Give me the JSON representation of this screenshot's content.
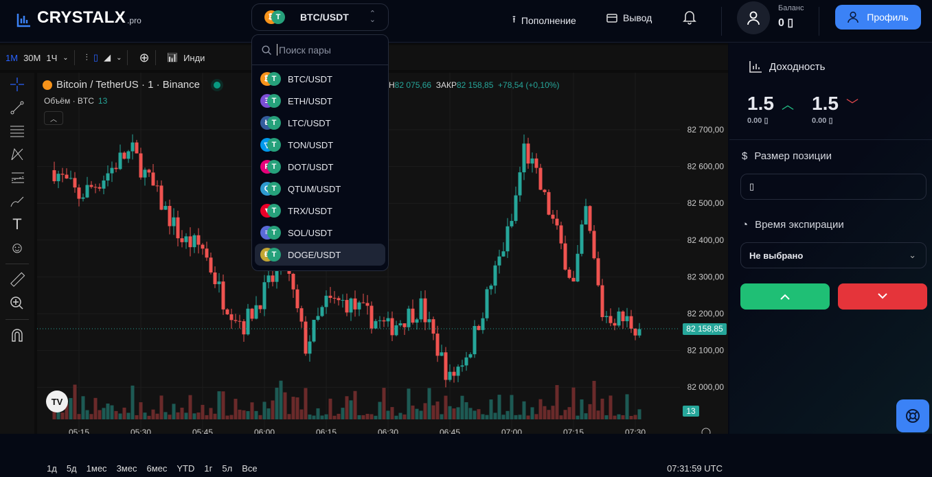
{
  "header": {
    "logo": "CRYSTALX",
    "logo_suffix": ".pro",
    "pair": "BTC/USDT",
    "deposit": "Пополнение",
    "withdraw": "Вывод",
    "balance_label": "Баланс",
    "balance_value": "0 ▯",
    "profile": "Профиль"
  },
  "toolbar": {
    "intervals": [
      "1М",
      "30М",
      "1Ч"
    ],
    "active_interval": "1М",
    "indicators": "Инди"
  },
  "chart": {
    "title": "Bitcoin / TetherUS · 1 · Binance",
    "volume_label": "Объём · BTC",
    "volume_value": "13",
    "ohlc_prefix": "Н",
    "low": "82 075,66",
    "close_label": "ЗАКР",
    "close": "82 158,85",
    "change": "+78,54 (+0,10%)",
    "price_ticks": [
      "82 700,00",
      "82 600,00",
      "82 500,00",
      "82 400,00",
      "82 300,00",
      "82 200,00",
      "82 100,00",
      "82 000,00"
    ],
    "current_price": "82 158,85",
    "volume_badge": "13",
    "time_ticks": [
      "05:15",
      "05:30",
      "05:45",
      "06:00",
      "06:15",
      "06:30",
      "06:45",
      "07:00",
      "07:15",
      "07:30"
    ],
    "ranges": [
      "1д",
      "5д",
      "1мес",
      "3мес",
      "6мес",
      "YTD",
      "1г",
      "5л",
      "Все"
    ],
    "clock": "07:31:59 UTC",
    "up_color": "#26a69a",
    "down_color": "#ef5350",
    "path": [
      [
        "05:09",
        82590
      ],
      [
        "05:15",
        82520
      ],
      [
        "05:20",
        82560
      ],
      [
        "05:25",
        82620
      ],
      [
        "05:28",
        82640
      ],
      [
        "05:35",
        82500
      ],
      [
        "05:40",
        82400
      ],
      [
        "05:45",
        82380
      ],
      [
        "05:50",
        82240
      ],
      [
        "05:55",
        82170
      ],
      [
        "06:00",
        82260
      ],
      [
        "06:05",
        82340
      ],
      [
        "06:10",
        82110
      ],
      [
        "06:15",
        82230
      ],
      [
        "06:20",
        82230
      ],
      [
        "06:30",
        82160
      ],
      [
        "06:38",
        82220
      ],
      [
        "06:45",
        82020
      ],
      [
        "06:50",
        82110
      ],
      [
        "06:55",
        82280
      ],
      [
        "07:00",
        82450
      ],
      [
        "07:03",
        82650
      ],
      [
        "07:05",
        82600
      ],
      [
        "07:10",
        82450
      ],
      [
        "07:15",
        82280
      ],
      [
        "07:18",
        82480
      ],
      [
        "07:22",
        82200
      ],
      [
        "07:28",
        82180
      ],
      [
        "07:31",
        82158
      ]
    ]
  },
  "dropdown": {
    "placeholder": "Поиск пары",
    "pairs": [
      {
        "label": "BTC/USDT",
        "color": "#f7931a",
        "g": "₿"
      },
      {
        "label": "ETH/USDT",
        "color": "#7b4fd6",
        "g": "Ξ"
      },
      {
        "label": "LTC/USDT",
        "color": "#345d9d",
        "g": "Ł"
      },
      {
        "label": "TON/USDT",
        "color": "#0098ea",
        "g": "▽"
      },
      {
        "label": "DOT/USDT",
        "color": "#e6007a",
        "g": "P"
      },
      {
        "label": "QTUM/USDT",
        "color": "#2e9ad0",
        "g": "Q"
      },
      {
        "label": "TRX/USDT",
        "color": "#eb0029",
        "g": "▼"
      },
      {
        "label": "SOL/USDT",
        "color": "#5a6bd8",
        "g": "≡"
      },
      {
        "label": "DOGE/USDT",
        "color": "#c2a633",
        "g": "Ð"
      }
    ],
    "selected": "DOGE/USDT"
  },
  "panel": {
    "yield_title": "Доходность",
    "up_rate": "1.5",
    "up_amount": "0.00 ▯",
    "down_rate": "1.5",
    "down_amount": "0.00 ▯",
    "size_label": "Размер позиции",
    "size_value": "▯",
    "expiry_label": "Время экспирации",
    "expiry_value": "Не выбрано"
  }
}
